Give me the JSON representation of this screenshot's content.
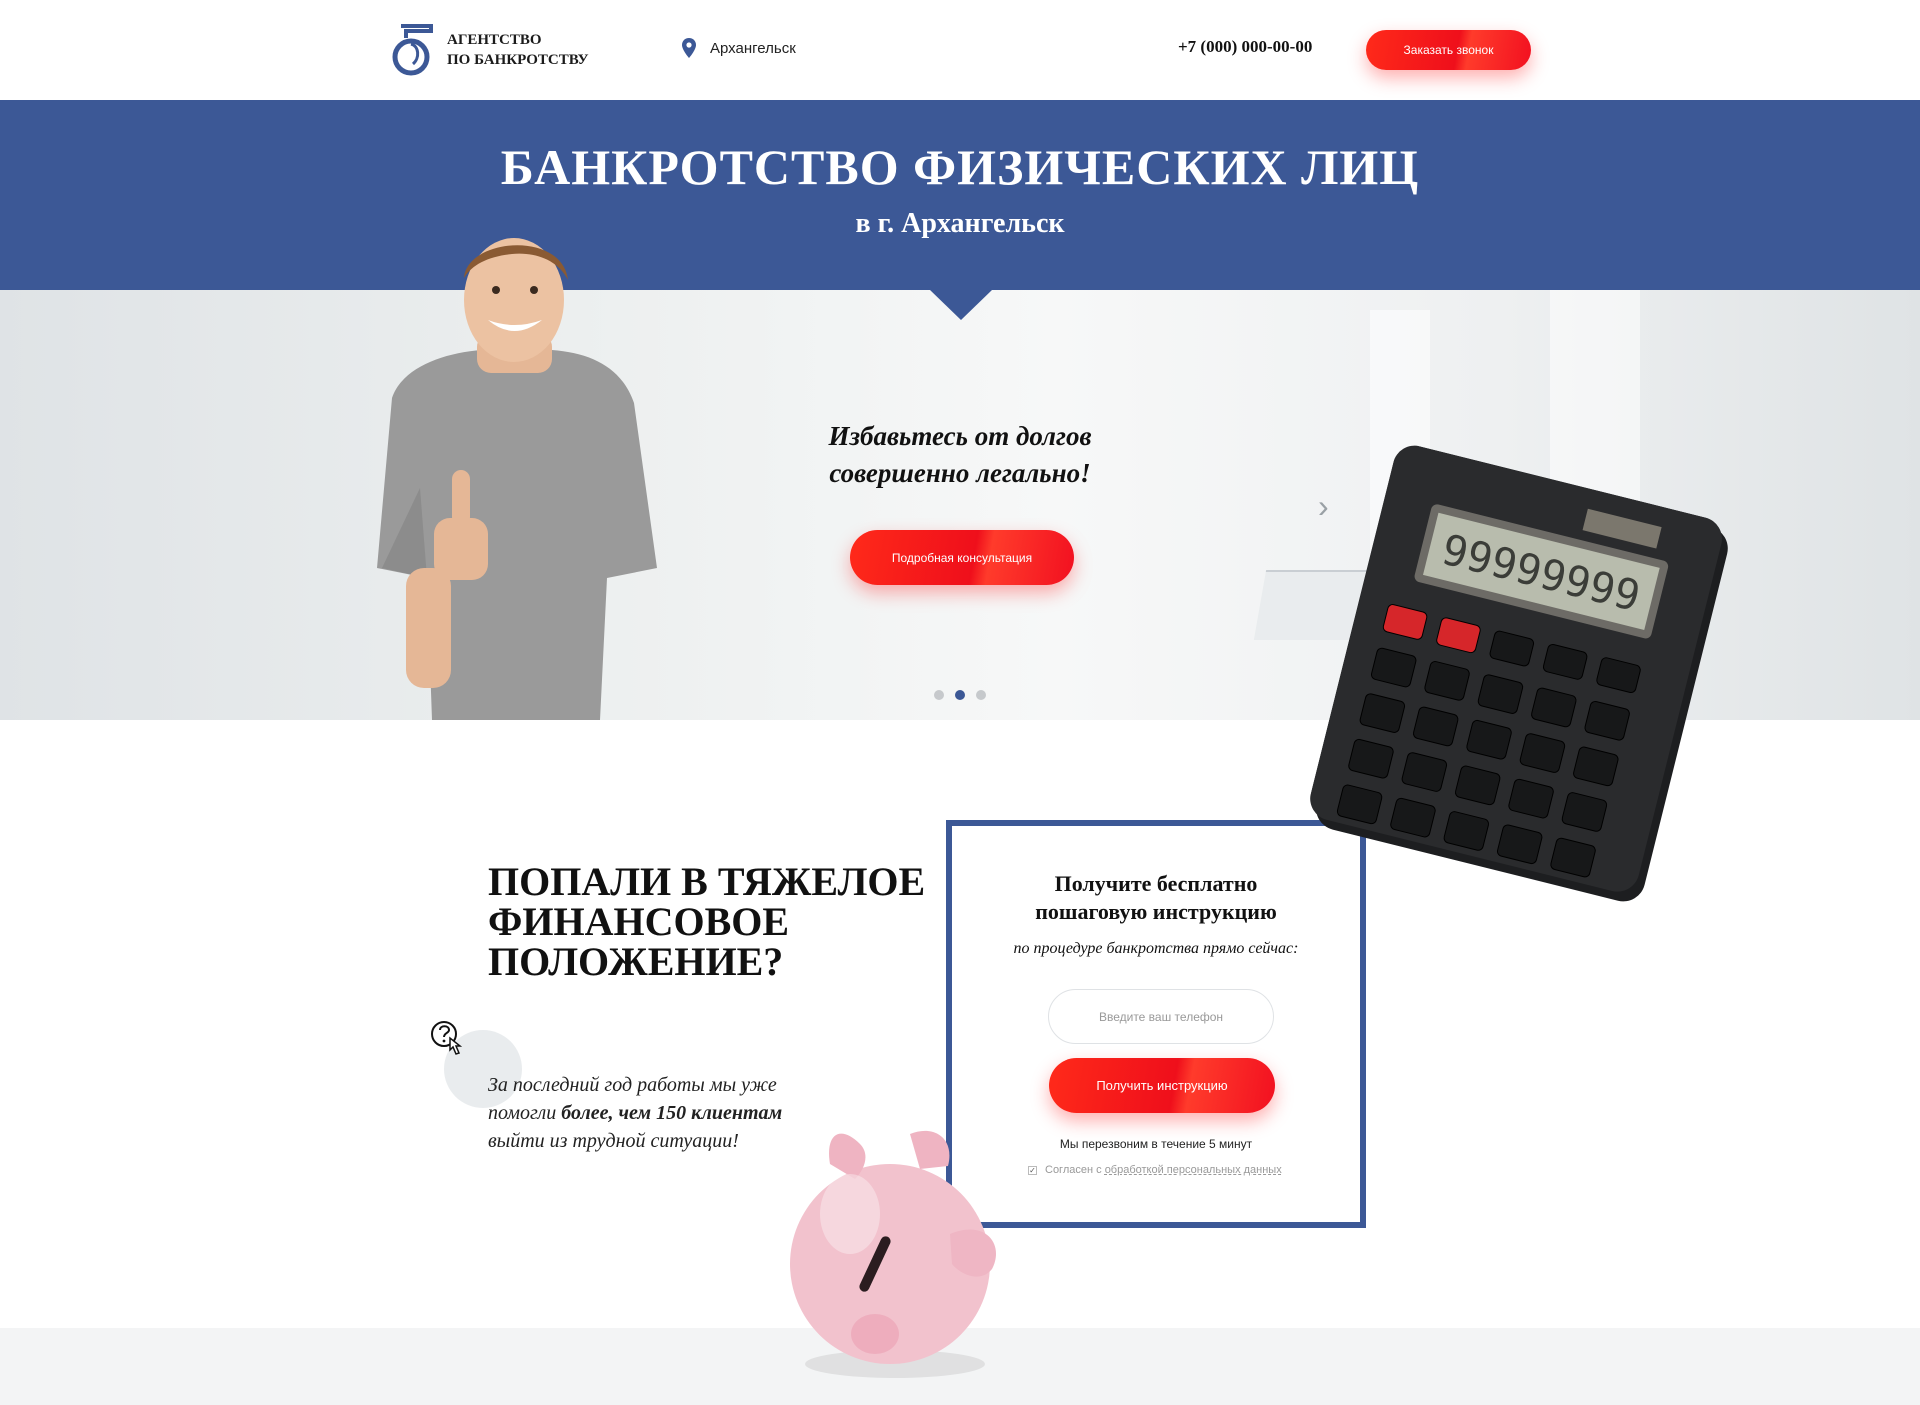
{
  "header": {
    "logo_line1": "АГЕНТСТВО",
    "logo_line2": "ПО БАНКРОТСТВУ",
    "city": "Архангельск",
    "phone": "+7 (000) 000-00-00",
    "call_button": "Заказать звонок"
  },
  "banner": {
    "title": "БАНКРОТСТВО ФИЗИЧЕСКИХ ЛИЦ",
    "subtitle": "в г. Архангельск"
  },
  "hero": {
    "line1": "Избавьтесь от долгов",
    "line2": "совершенно легально!",
    "consult_button": "Подробная консультация",
    "slides_total": 3,
    "active_slide": 2
  },
  "problem": {
    "title_line1": "ПОПАЛИ В ТЯЖЕЛОЕ",
    "title_line2": "ФИНАНСОВОЕ",
    "title_line3": "ПОЛОЖЕНИЕ?",
    "text_before": "За последний год работы мы уже помогли ",
    "text_bold": "более, чем 150 клиентам",
    "text_after": " выйти из трудной ситуации!"
  },
  "form": {
    "title_line1": "Получите бесплатно",
    "title_line2": "пошаговую инструкцию",
    "subtitle": "по процедуре банкротства прямо сейчас:",
    "phone_placeholder": "Введите ваш телефон",
    "submit_button": "Получить инструкцию",
    "callback_note": "Мы перезвоним в течение 5 минут",
    "consent_prefix": "Согласен с ",
    "consent_link": "обработкой персональных данных"
  },
  "calculator_display": "99999999",
  "colors": {
    "brand_blue": "#3c5896",
    "accent_red": "#f21020"
  },
  "icons": {
    "location": "location-pin-icon",
    "prev": "chevron-left-icon",
    "next": "chevron-right-icon",
    "help": "question-pointer-icon"
  }
}
